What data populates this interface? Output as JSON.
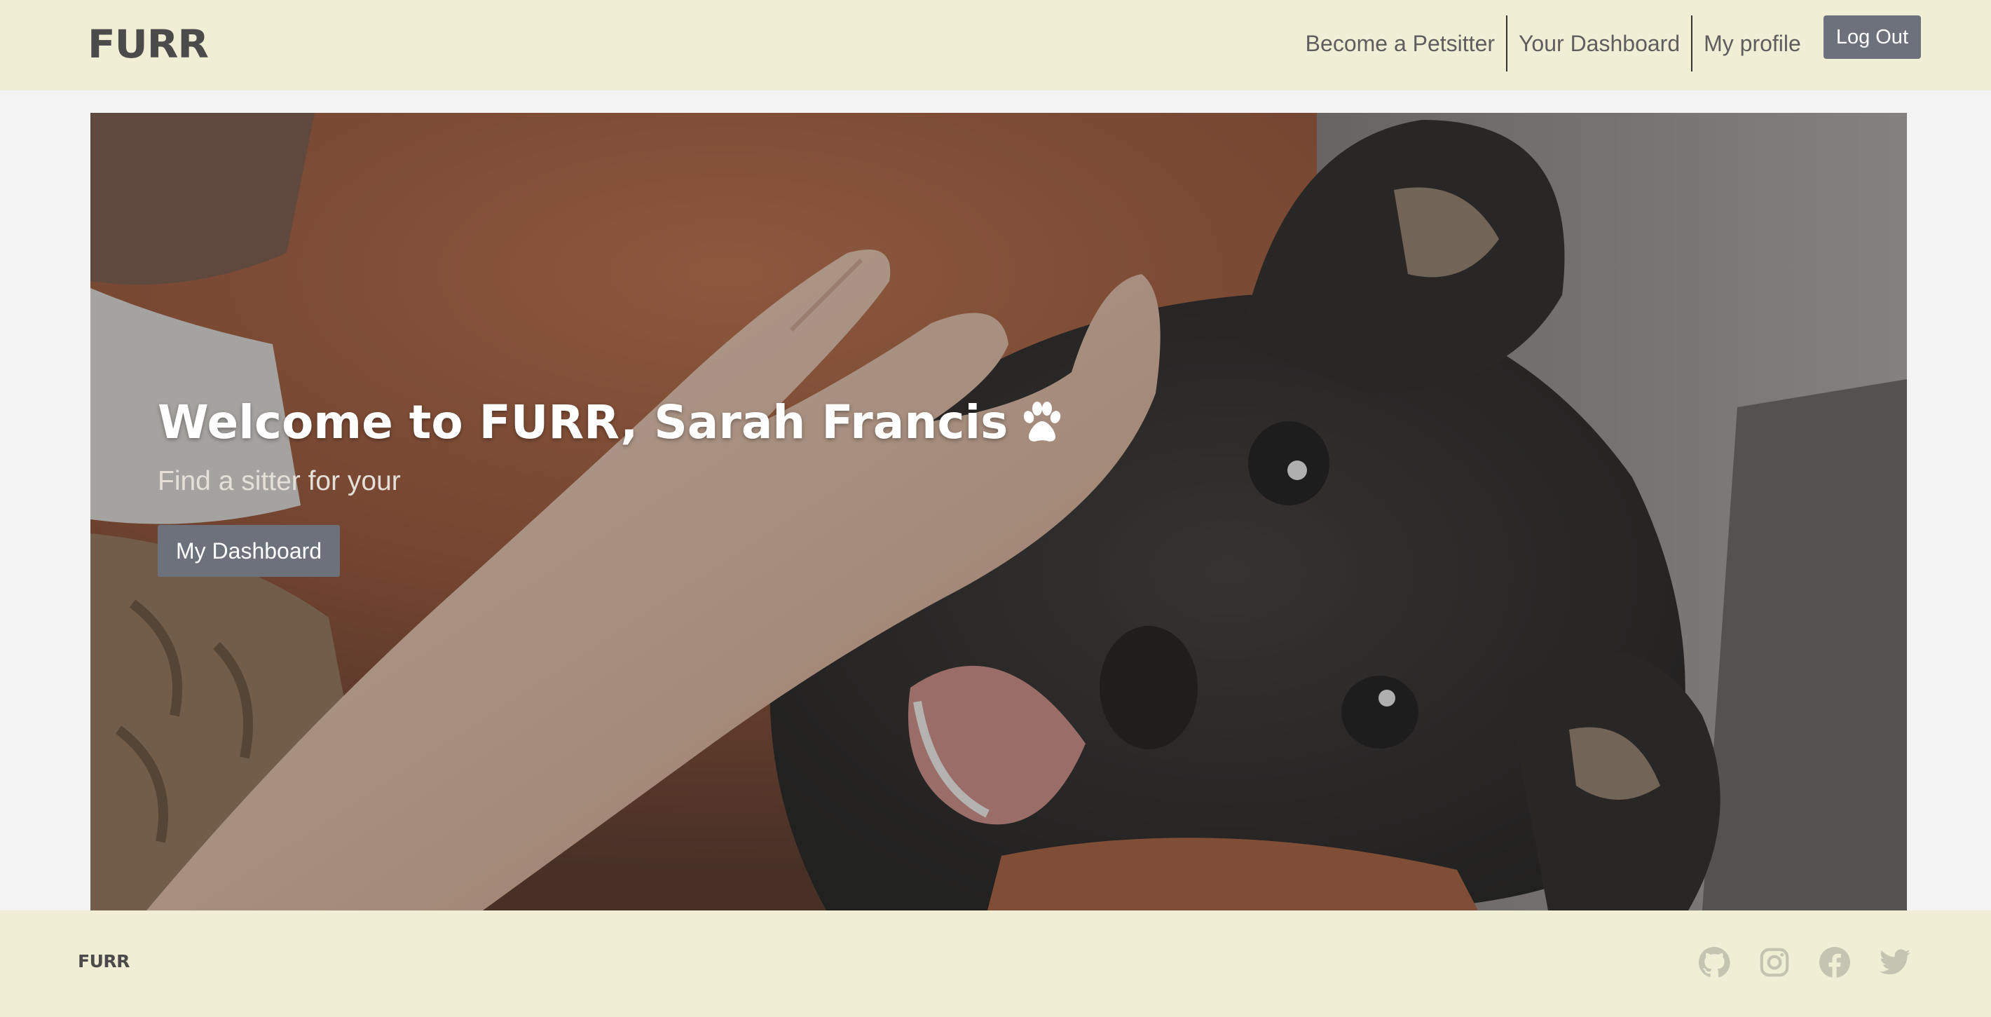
{
  "brand": {
    "logo_text": "FURR"
  },
  "nav": {
    "links": [
      {
        "label": "Become a Petsitter"
      },
      {
        "label": "Your Dashboard"
      },
      {
        "label": "My profile"
      }
    ],
    "logout_label": "Log Out"
  },
  "hero": {
    "title": "Welcome to FURR, Sarah Francis",
    "title_icon": "paw-icon",
    "subtitle": "Find a sitter for your",
    "button_label": "My Dashboard"
  },
  "footer": {
    "logo_text": "FURR",
    "social_icons": [
      "github-icon",
      "instagram-icon",
      "facebook-icon",
      "twitter-icon"
    ]
  },
  "colors": {
    "header_bg": "#f1eed6",
    "page_bg": "#f3f3f3",
    "button_bg": "#6c717c",
    "social_icon": "#c5c3b2"
  }
}
